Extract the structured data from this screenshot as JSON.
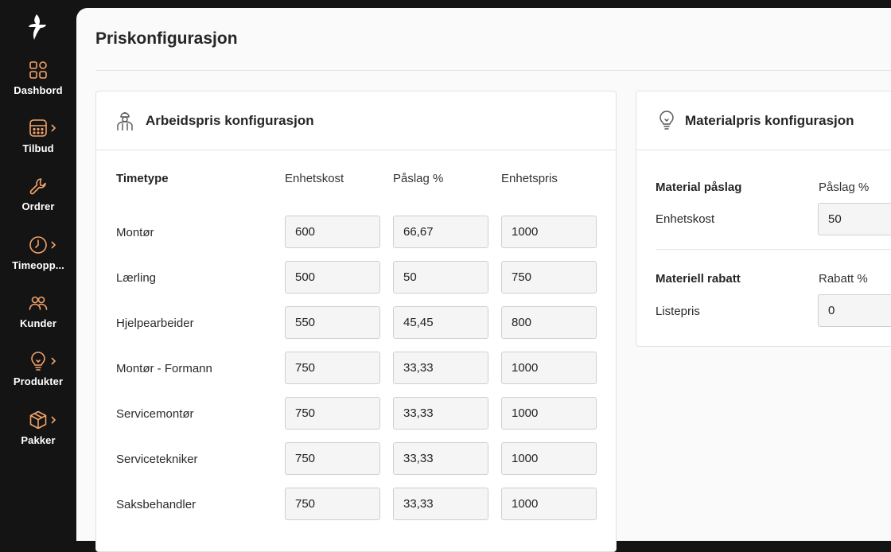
{
  "sidebar": {
    "items": [
      {
        "label": "Dashbord",
        "icon": "grid-icon",
        "chevron": false
      },
      {
        "label": "Tilbud",
        "icon": "calculator-icon",
        "chevron": true
      },
      {
        "label": "Ordrer",
        "icon": "wrench-icon",
        "chevron": false
      },
      {
        "label": "Timeopp...",
        "icon": "clock-icon",
        "chevron": true
      },
      {
        "label": "Kunder",
        "icon": "users-icon",
        "chevron": false
      },
      {
        "label": "Produkter",
        "icon": "lightbulb-icon",
        "chevron": true
      },
      {
        "label": "Pakker",
        "icon": "package-icon",
        "chevron": true
      }
    ]
  },
  "page": {
    "title": "Priskonfigurasjon"
  },
  "labor": {
    "title": "Arbeidspris konfigurasjon",
    "headers": {
      "type": "Timetype",
      "cost": "Enhetskost",
      "markup": "Påslag %",
      "price": "Enhetspris"
    },
    "rows": [
      {
        "label": "Montør",
        "cost": "600",
        "markup": "66,67",
        "price": "1000"
      },
      {
        "label": "Lærling",
        "cost": "500",
        "markup": "50",
        "price": "750"
      },
      {
        "label": "Hjelpearbeider",
        "cost": "550",
        "markup": "45,45",
        "price": "800"
      },
      {
        "label": "Montør - Formann",
        "cost": "750",
        "markup": "33,33",
        "price": "1000"
      },
      {
        "label": "Servicemontør",
        "cost": "750",
        "markup": "33,33",
        "price": "1000"
      },
      {
        "label": "Servicetekniker",
        "cost": "750",
        "markup": "33,33",
        "price": "1000"
      },
      {
        "label": "Saksbehandler",
        "cost": "750",
        "markup": "33,33",
        "price": "1000"
      }
    ]
  },
  "material": {
    "title": "Materialpris konfigurasjon",
    "markup_section": {
      "heading": "Material påslag",
      "column": "Påslag %",
      "row_label": "Enhetskost",
      "value": "50"
    },
    "discount_section": {
      "heading": "Materiell rabatt",
      "column": "Rabatt %",
      "row_label": "Listepris",
      "value": "0"
    }
  },
  "colors": {
    "accent": "#f2a36b",
    "sidebar_bg": "#141414",
    "main_bg": "#fafafa"
  }
}
